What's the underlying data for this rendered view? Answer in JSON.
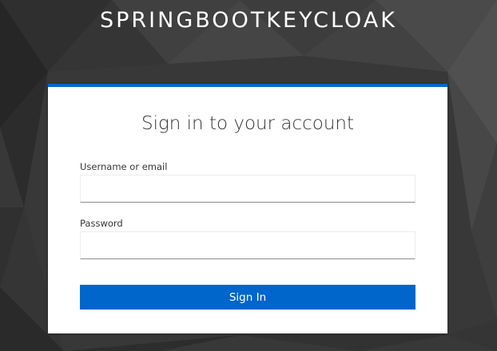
{
  "realm": {
    "title": "SPRINGBOOTKEYCLOAK"
  },
  "login": {
    "heading": "Sign in to your account",
    "username_label": "Username or email",
    "username_value": "",
    "password_label": "Password",
    "password_value": "",
    "submit_label": "Sign In"
  },
  "colors": {
    "accent": "#0066cc",
    "background": "#3a3a3a",
    "card": "#ffffff"
  }
}
